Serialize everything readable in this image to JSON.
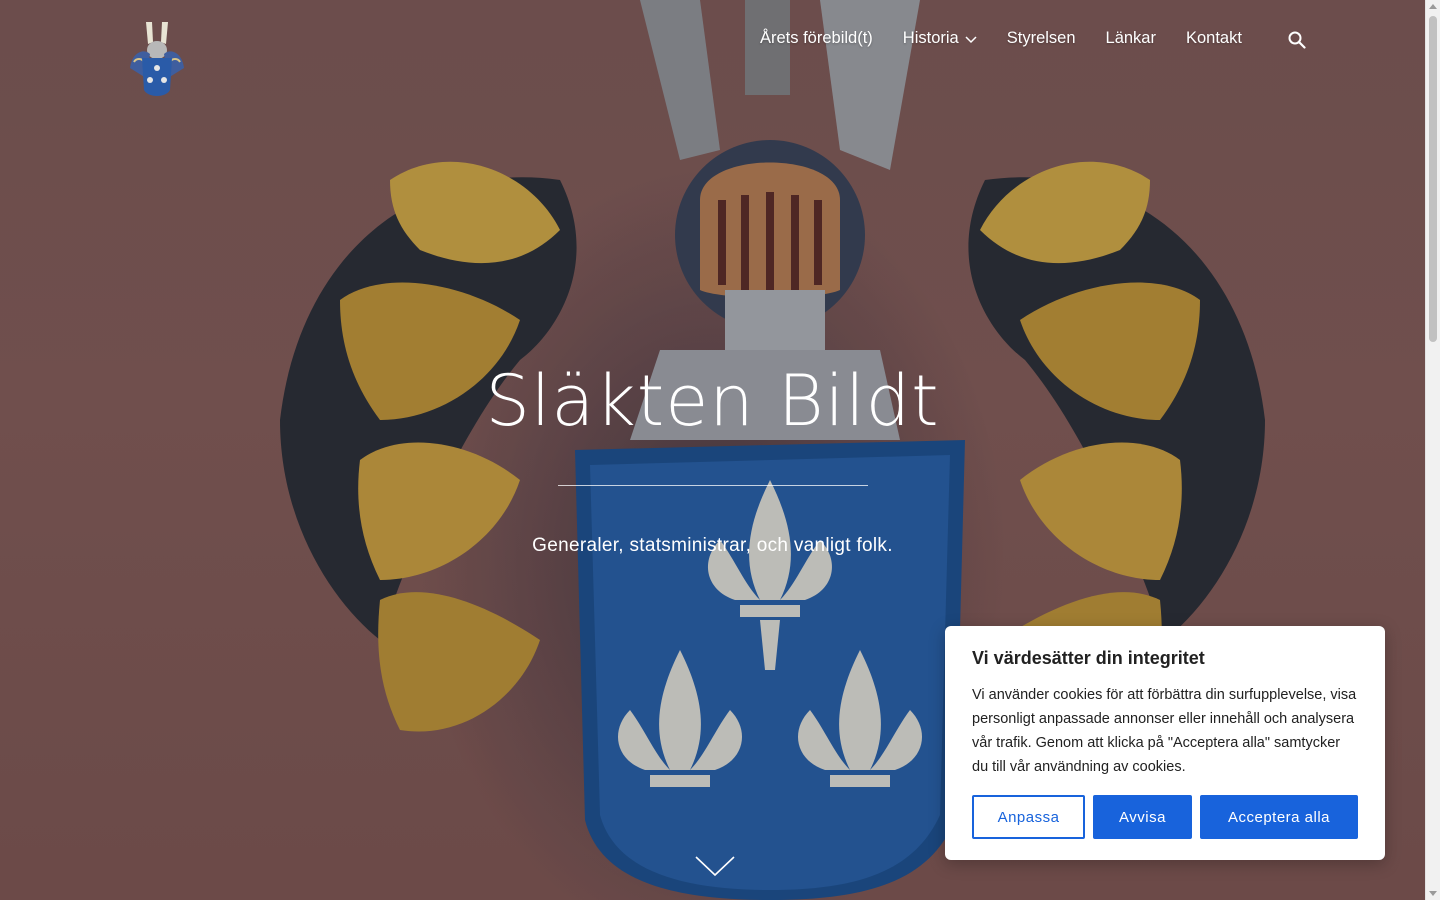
{
  "header": {
    "logo_name": "coat-of-arms-logo",
    "nav": [
      {
        "label": "Årets förebild(t)",
        "has_dropdown": false
      },
      {
        "label": "Historia",
        "has_dropdown": true
      },
      {
        "label": "Styrelsen",
        "has_dropdown": false
      },
      {
        "label": "Länkar",
        "has_dropdown": false
      },
      {
        "label": "Kontakt",
        "has_dropdown": false
      }
    ],
    "search_icon": "search-icon"
  },
  "hero": {
    "title": "Släkten Bildt",
    "subtitle": "Generaler, statsministrar, och vanligt folk.",
    "scroll_icon": "chevron-down-icon"
  },
  "cookie_banner": {
    "title": "Vi värdesätter din integritet",
    "text": "Vi använder cookies för att förbättra din surfupplevelse, visa personligt anpassade annonser eller innehåll och analysera vår trafik. Genom att klicka på \"Acceptera alla\" samtycker du till vår användning av cookies.",
    "buttons": {
      "customize": "Anpassa",
      "reject": "Avvisa",
      "accept": "Acceptera alla"
    },
    "accent_color": "#1863dc"
  }
}
